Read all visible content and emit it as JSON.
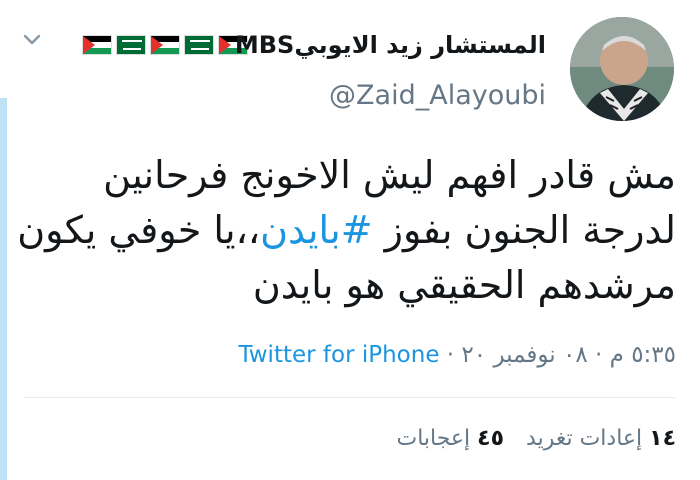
{
  "author": {
    "name": "المستشار زيد الايوبيMBS",
    "handle": "@Zaid_Alayoubi",
    "flag_icons": [
      "palestine-flag-icon",
      "saudi-flag-icon",
      "palestine-flag-icon",
      "saudi-flag-icon",
      "palestine-flag-icon"
    ]
  },
  "tweet": {
    "text_part1": "مش قادر افهم ليش الاخونج فرحانين لدرجة الجنون بفوز ",
    "hashtag": "#بايدن",
    "text_part2": "،،يا خوفي يكون مرشدهم الحقيقي هو بايدن"
  },
  "meta": {
    "time": "٥:٣٥ م",
    "separator": " · ",
    "date": "٠٨ نوفمبر ٢٠",
    "app": "Twitter for iPhone"
  },
  "stats": {
    "retweets_count": "١٤",
    "retweets_label": "إعادات تغريد",
    "likes_count": "٤٥",
    "likes_label": "إعجابات"
  },
  "colors": {
    "link": "#1b95e0",
    "secondary_text": "#657786",
    "primary_text": "#14171a"
  }
}
